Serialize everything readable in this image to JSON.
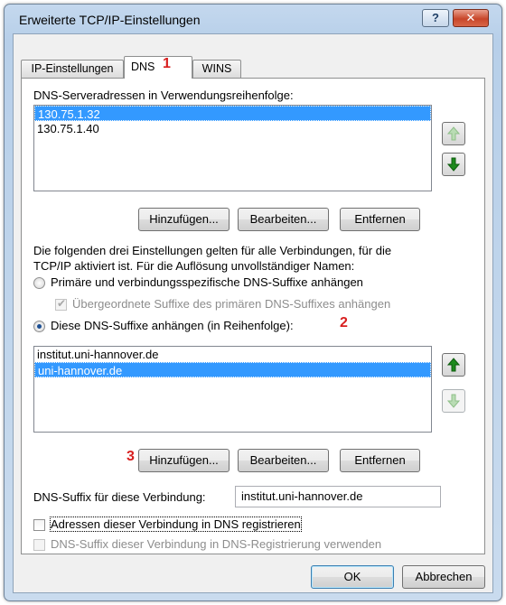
{
  "window": {
    "title": "Erweiterte TCP/IP-Einstellungen",
    "help_label": "?",
    "close_label": "✕"
  },
  "tabs": [
    {
      "label": "IP-Einstellungen",
      "active": false
    },
    {
      "label": "DNS",
      "active": true
    },
    {
      "label": "WINS",
      "active": false
    }
  ],
  "annotations": {
    "marker1": "1",
    "marker2": "2",
    "marker3": "3",
    "color": "#d81f1f"
  },
  "dns_servers": {
    "label": "DNS-Serveradressen in Verwendungsreihenfolge:",
    "items": [
      "130.75.1.32",
      "130.75.1.40"
    ],
    "selected_index": 0,
    "buttons": {
      "add": "Hinzufügen...",
      "edit": "Bearbeiten...",
      "remove": "Entfernen"
    }
  },
  "info_text": {
    "line1": "Die folgenden drei Einstellungen gelten für alle Verbindungen, für die",
    "line2": "TCP/IP aktiviert ist. Für die Auflösung unvollständiger Namen:"
  },
  "options": {
    "primary_suffix": "Primäre und verbindungsspezifische DNS-Suffixe anhängen",
    "parent_suffix": "Übergeordnete Suffixe des primären DNS-Suffixes anhängen",
    "these_suffixes": "Diese DNS-Suffixe anhängen (in Reihenfolge):"
  },
  "suffix_list": {
    "items": [
      "institut.uni-hannover.de",
      "uni-hannover.de"
    ],
    "selected_index": 1,
    "buttons": {
      "add": "Hinzufügen...",
      "edit": "Bearbeiten...",
      "remove": "Entfernen"
    }
  },
  "connection_suffix": {
    "label": "DNS-Suffix für diese Verbindung:",
    "value": "institut.uni-hannover.de"
  },
  "checkboxes": {
    "register": "Adressen dieser Verbindung in DNS registrieren",
    "use_suffix": "DNS-Suffix dieser Verbindung in DNS-Registrierung verwenden"
  },
  "footer": {
    "ok": "OK",
    "cancel": "Abbrechen"
  },
  "colors": {
    "selection": "#3399ff",
    "arrow_green": "#1e8a1e"
  }
}
